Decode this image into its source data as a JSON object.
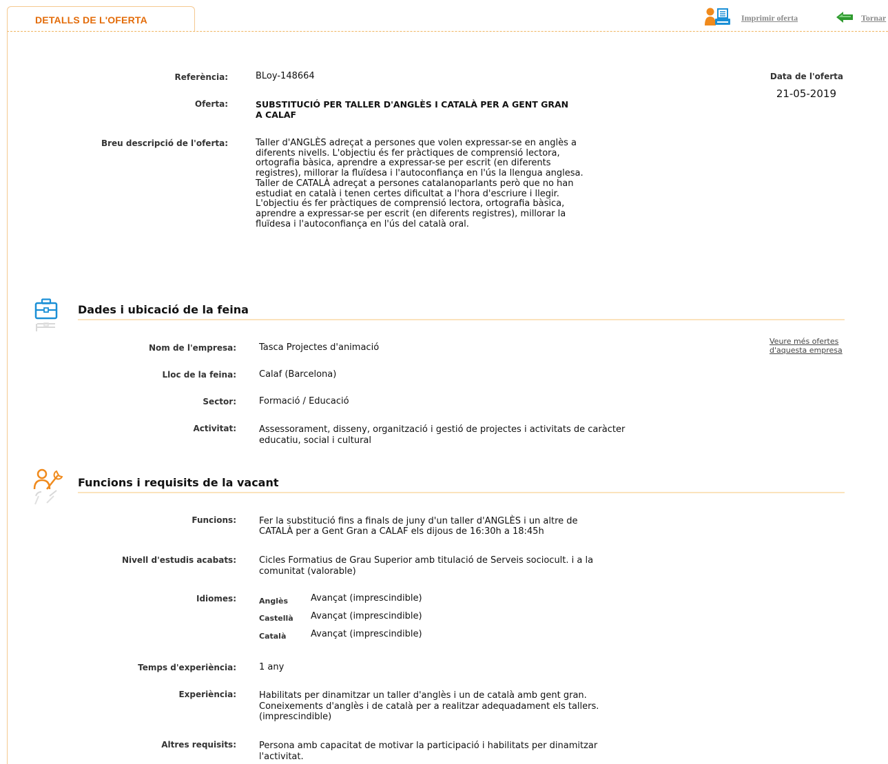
{
  "tab": {
    "label": "DETALLS DE L'OFERTA"
  },
  "toolbar": {
    "print_label": "Imprimir oferta",
    "back_label": "Tornar"
  },
  "offer": {
    "reference_label": "Referència:",
    "reference_value": "BLoy-148664",
    "title_label": "Oferta:",
    "title_line1": "SUBSTITUCIÓ PER TALLER D'ANGLÈS I CATALÀ PER A GENT GRAN",
    "title_line2": "A CALAF",
    "desc_label": "Breu descripció de l'oferta:",
    "desc_lines": [
      "Taller d'ANGLÈS adreçat a persones que volen expressar-se en anglès a",
      "diferents nivells. L'objectiu és fer pràctiques de comprensió lectora,",
      "ortografia bàsica, aprendre a expressar-se per escrit (en diferents",
      "registres), millorar la fluïdesa i l'autoconfiança en l'ús la llengua anglesa.",
      "Taller de CATALÀ adreçat a persones catalanoparlants però que no han",
      "estudiat en català i tenen certes dificultat a l'hora d'escriure i llegir.",
      "L'objectiu és fer pràctiques de comprensió lectora, ortografia bàsica,",
      "aprendre a expressar-se per escrit (en diferents registres), millorar la",
      "fluïdesa i l'autoconfiança en l'ús del català oral."
    ],
    "date_label": "Data de l'oferta",
    "date_value": "21-05-2019"
  },
  "section_job": {
    "title": "Dades i ubicació de la feina",
    "more_offers_line1": "Veure més ofertes",
    "more_offers_line2": "d'aquesta empresa",
    "company_label": "Nom de l'empresa:",
    "company_value": "Tasca Projectes d'animació",
    "location_label": "Lloc de la feina:",
    "location_value": "Calaf (Barcelona)",
    "sector_label": "Sector:",
    "sector_value": "Formació / Educació",
    "activity_label": "Activitat:",
    "activity_line1": "Assessorament, disseny, organització i gestió de projectes i activitats de caràcter",
    "activity_line2": "educatiu, social i cultural"
  },
  "section_req": {
    "title": "Funcions i requisits de la vacant",
    "functions_label": "Funcions:",
    "functions_line1": "Fer la substitució fins a finals de juny d'un taller d'ANGLÈS i un altre de",
    "functions_line2": "CATALÀ per a Gent Gran a CALAF els dijous de 16:30h a 18:45h",
    "studies_label": "Nivell d'estudis acabats:",
    "studies_line1": "Cicles Formatius de Grau Superior amb titulació de Serveis sociocult. i a la",
    "studies_line2": "comunitat (valorable)",
    "languages_label": "Idiomes:",
    "languages": [
      {
        "name": "Anglès",
        "level": "Avançat (imprescindible)"
      },
      {
        "name": "Castellà",
        "level": "Avançat (imprescindible)"
      },
      {
        "name": "Català",
        "level": "Avançat (imprescindible)"
      }
    ],
    "exp_time_label": "Temps d'experiència:",
    "exp_time_value": "1 any",
    "experience_label": "Experiència:",
    "experience_line1": "Habilitats per dinamitzar un taller d'anglès i un de català amb gent gran.",
    "experience_line2": "Coneixements d'anglès i de català per a realitzar adequadament els tallers.",
    "experience_line3": "(imprescindible)",
    "other_label": "Altres requisits:",
    "other_line1": "Persona amb capacitat de motivar la participació i habilitats per dinamitzar",
    "other_line2": "l'activitat."
  },
  "colors": {
    "accent_orange": "#e36c0a",
    "tab_border": "#f5c88f",
    "icon_blue": "#1a8fd6",
    "icon_orange": "#f08a1c",
    "back_arrow_green": "#2e9a2e"
  },
  "icons": [
    "print-icon",
    "back-arrow-icon",
    "briefcase-icon",
    "person-wrench-icon"
  ]
}
